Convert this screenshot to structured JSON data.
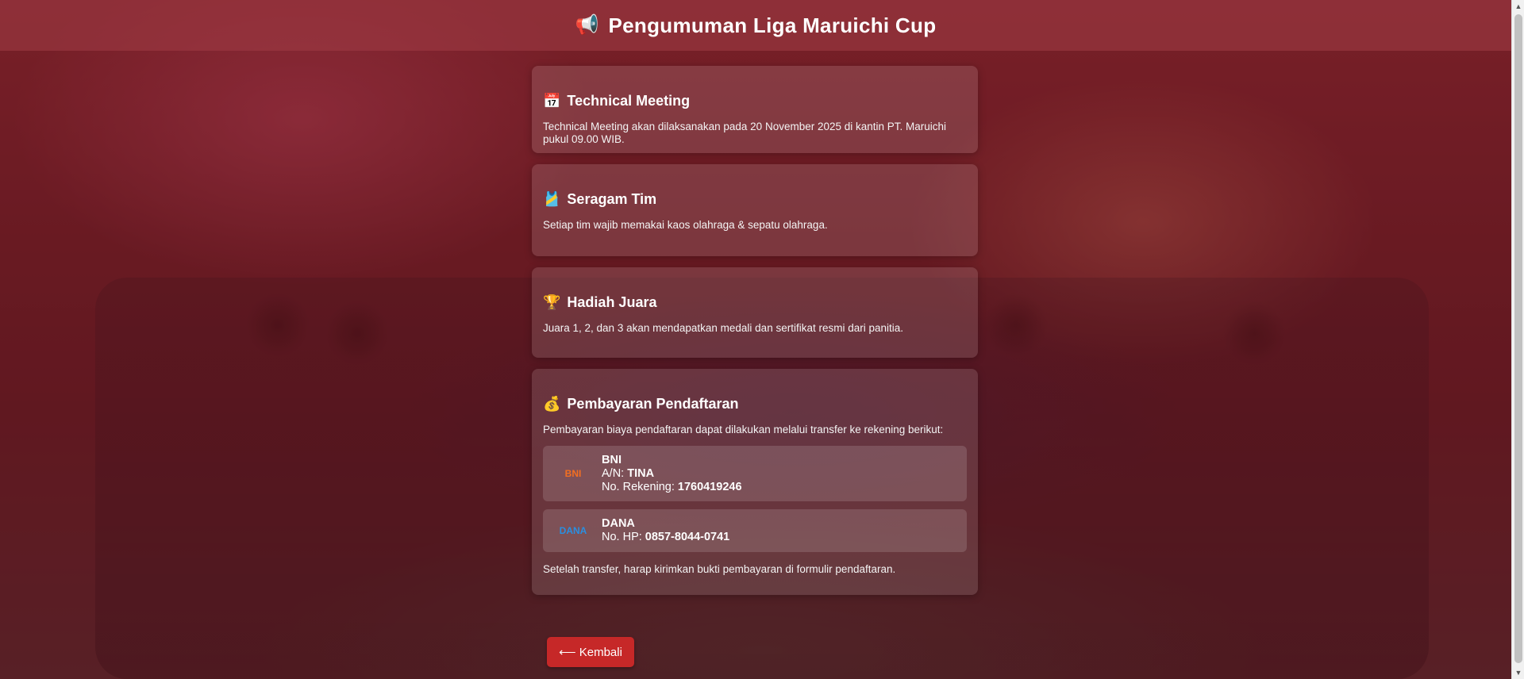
{
  "header": {
    "icon": "📢",
    "title": "Pengumuman Liga Maruichi Cup"
  },
  "cards": {
    "meeting": {
      "icon": "📅",
      "title": "Technical Meeting",
      "text": "Technical Meeting akan dilaksanakan pada 20 November 2025 di kantin PT. Maruichi pukul 09.00 WIB."
    },
    "uniform": {
      "icon": "🎽",
      "title": "Seragam Tim",
      "text": "Setiap tim wajib memakai kaos olahraga & sepatu olahraga."
    },
    "prize": {
      "icon": "🏆",
      "title": "Hadiah Juara",
      "text": "Juara 1, 2, dan 3 akan mendapatkan medali dan sertifikat resmi dari panitia."
    },
    "payment": {
      "icon": "💰",
      "title": "Pembayaran Pendaftaran",
      "intro": "Pembayaran biaya pendaftaran dapat dilakukan melalui transfer ke rekening berikut:",
      "bni": {
        "logo_text": "BNI",
        "name": "BNI",
        "holder_label": "A/N:",
        "holder": "TINA",
        "account_label": "No. Rekening:",
        "account": "1760419246"
      },
      "dana": {
        "logo_text": "DANA",
        "name": "DANA",
        "phone_label": "No. HP:",
        "phone": "0857-8044-0741"
      },
      "footer": "Setelah transfer, harap kirimkan bukti pembayaran di formulir pendaftaran."
    }
  },
  "back_button": {
    "label": "⟵ Kembali"
  },
  "colors": {
    "accent": "#c62828",
    "overlay": "#78141e"
  }
}
